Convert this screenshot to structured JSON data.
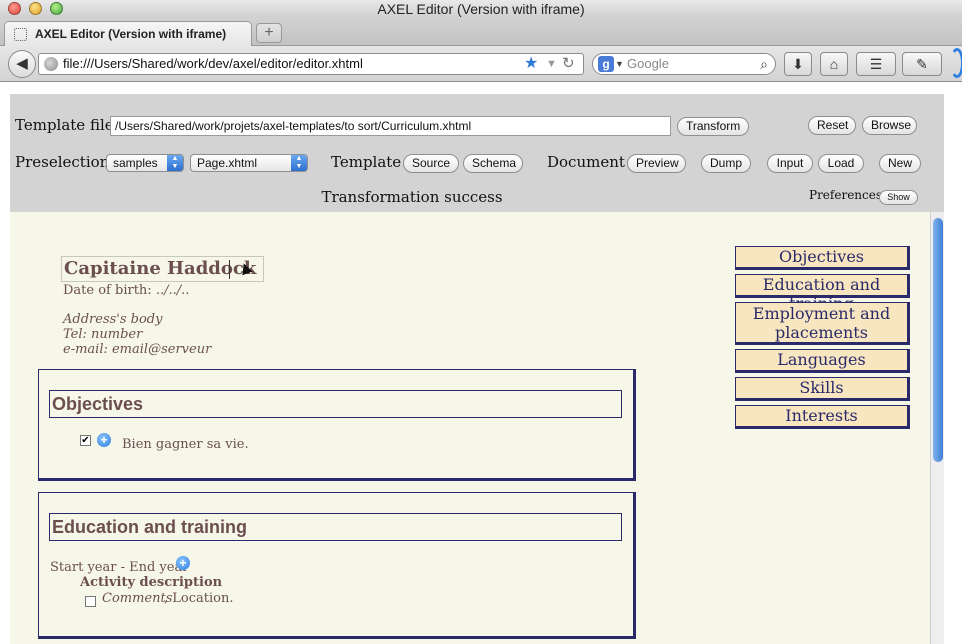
{
  "window": {
    "title": "AXEL Editor (Version with iframe)"
  },
  "tab": {
    "title": "AXEL Editor (Version with iframe)",
    "new_tab": "+"
  },
  "nav": {
    "back": "◀",
    "url": "file:///Users/Shared/work/dev/axel/editor/editor.xhtml",
    "reload": "↻",
    "search_engine": "g",
    "search_placeholder": "Google",
    "buttons": {
      "download": "⬇",
      "home": "⌂",
      "bookmarks": "☰",
      "extensions": "✎"
    }
  },
  "panel": {
    "template_file_label": "Template file :",
    "template_file_value": "/Users/Shared/work/projets/axel-templates/to sort/Curriculum.xhtml",
    "transform": "Transform",
    "reset": "Reset",
    "browse": "Browse",
    "preselection_label": "Preselection :",
    "preselection_folder": "samples",
    "preselection_file": "Page.xhtml",
    "template_label": "Template :",
    "source": "Source",
    "schema": "Schema",
    "document_label": "Document :",
    "preview": "Preview",
    "dump": "Dump",
    "input": "Input",
    "load": "Load",
    "new": "New",
    "status": "Transformation success",
    "preferences_label": "Preferences :",
    "show": "Show"
  },
  "doc": {
    "name": "Capitaine Haddock",
    "dob_label": "Date of birth:",
    "dob_value": "../../..",
    "address": "Address's body",
    "tel": "Tel: number",
    "email": "e-mail: email@serveur",
    "objectives": {
      "title": "Objectives",
      "item": "Bien gagner sa vie.",
      "checked": true
    },
    "education": {
      "title": "Education and training",
      "years": "Start year - End year",
      "activity": "Activity description",
      "comments": "Comments",
      "location": ", Location."
    }
  },
  "menu": [
    "Objectives",
    "Education and training",
    "Employment and placements",
    "Languages",
    "Skills",
    "Interests"
  ]
}
